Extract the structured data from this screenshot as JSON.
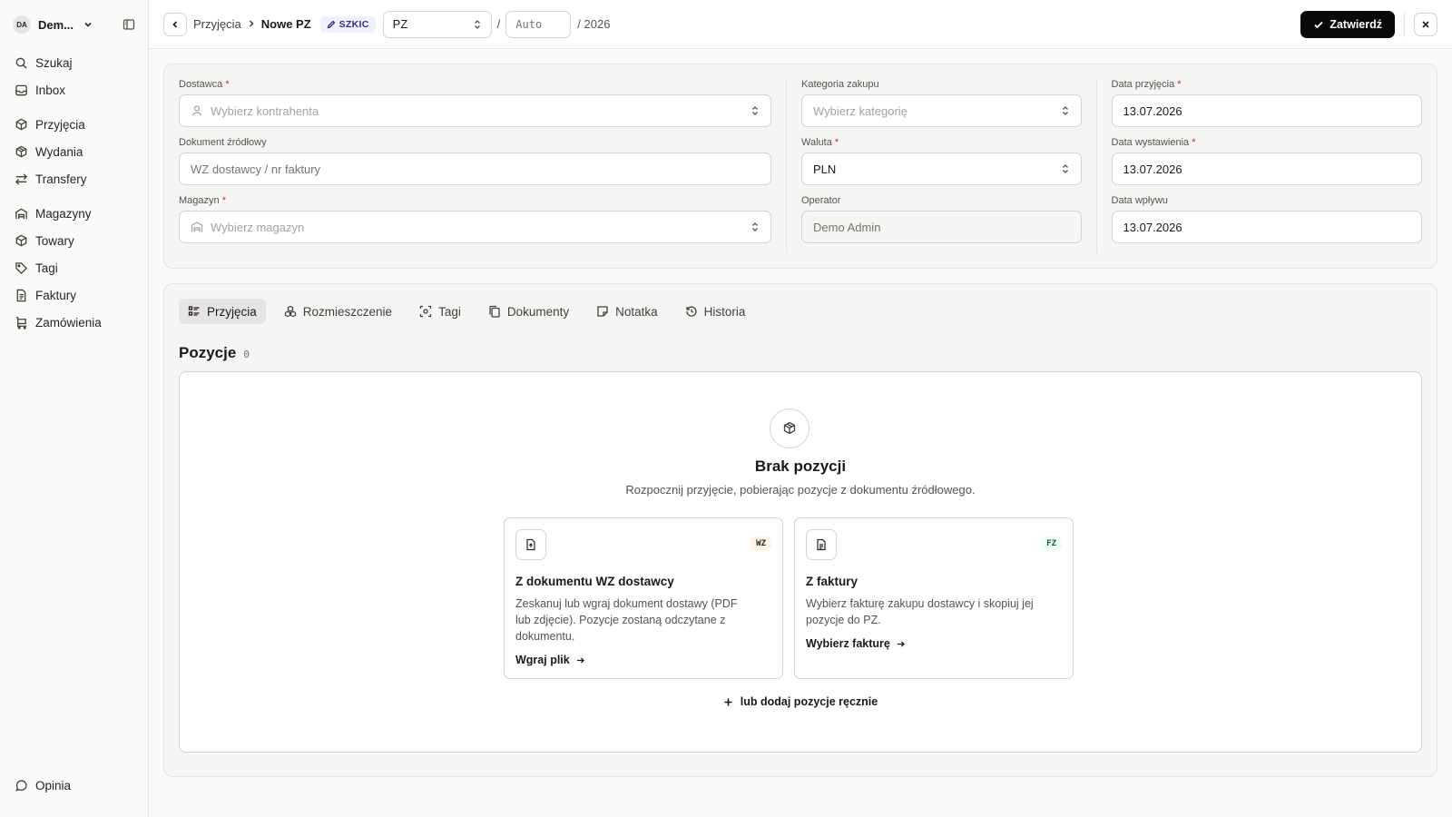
{
  "sidebar": {
    "workspace": {
      "initials": "DA",
      "name": "Dem..."
    },
    "groups": [
      [
        {
          "label": "Szukaj",
          "icon": "search-icon"
        },
        {
          "label": "Inbox",
          "icon": "inbox-icon"
        }
      ],
      [
        {
          "label": "Przyjęcia",
          "icon": "package-in-icon"
        },
        {
          "label": "Wydania",
          "icon": "package-out-icon"
        },
        {
          "label": "Transfery",
          "icon": "transfer-icon"
        }
      ],
      [
        {
          "label": "Magazyny",
          "icon": "warehouse-icon"
        },
        {
          "label": "Towary",
          "icon": "box-icon"
        },
        {
          "label": "Tagi",
          "icon": "tag-icon"
        },
        {
          "label": "Faktury",
          "icon": "invoice-icon"
        },
        {
          "label": "Zamówienia",
          "icon": "cart-icon"
        }
      ]
    ],
    "feedback": "Opinia"
  },
  "header": {
    "breadcrumb_parent": "Przyjęcia",
    "breadcrumb_current": "Nowe PZ",
    "status_badge": "SZKIC",
    "doc_type": "PZ",
    "number_placeholder": "Auto",
    "year": "/ 2026",
    "slash": "/",
    "confirm_label": "Zatwierdź"
  },
  "form": {
    "supplier": {
      "label": "Dostawca",
      "placeholder": "Wybierz kontrahenta"
    },
    "source_doc": {
      "label": "Dokument źródłowy",
      "placeholder": "WZ dostawcy / nr faktury"
    },
    "warehouse": {
      "label": "Magazyn",
      "placeholder": "Wybierz magazyn"
    },
    "category": {
      "label": "Kategoria zakupu",
      "placeholder": "Wybierz kategorię"
    },
    "currency": {
      "label": "Waluta",
      "value": "PLN"
    },
    "operator": {
      "label": "Operator",
      "value": "Demo Admin"
    },
    "receipt_date": {
      "label": "Data przyjęcia",
      "value": "13.07.2026"
    },
    "issue_date": {
      "label": "Data wystawienia",
      "value": "13.07.2026"
    },
    "arrival_date": {
      "label": "Data wpływu",
      "value": "13.07.2026"
    }
  },
  "tabs": [
    {
      "label": "Przyjęcia",
      "icon": "list-icon"
    },
    {
      "label": "Rozmieszczenie",
      "icon": "boxes-icon"
    },
    {
      "label": "Tagi",
      "icon": "scan-icon"
    },
    {
      "label": "Dokumenty",
      "icon": "copy-icon"
    },
    {
      "label": "Notatka",
      "icon": "note-icon"
    },
    {
      "label": "Historia",
      "icon": "history-icon"
    }
  ],
  "items": {
    "title": "Pozycje",
    "count": "0",
    "empty_title": "Brak pozycji",
    "empty_subtitle": "Rozpocznij przyjęcie, pobierając pozycje z dokumentu źródłowego.",
    "options": [
      {
        "tag": "WZ",
        "title": "Z dokumentu WZ dostawcy",
        "desc": "Zeskanuj lub wgraj dokument dostawy (PDF lub zdjęcie). Pozycje zostaną odczytane z dokumentu.",
        "link": "Wgraj plik"
      },
      {
        "tag": "FZ",
        "title": "Z faktury",
        "desc": "Wybierz fakturę zakupu dostawcy i skopiuj jej pozycje do PZ.",
        "link": "Wybierz fakturę"
      }
    ],
    "manual_add": "lub dodaj pozycje ręcznie"
  }
}
